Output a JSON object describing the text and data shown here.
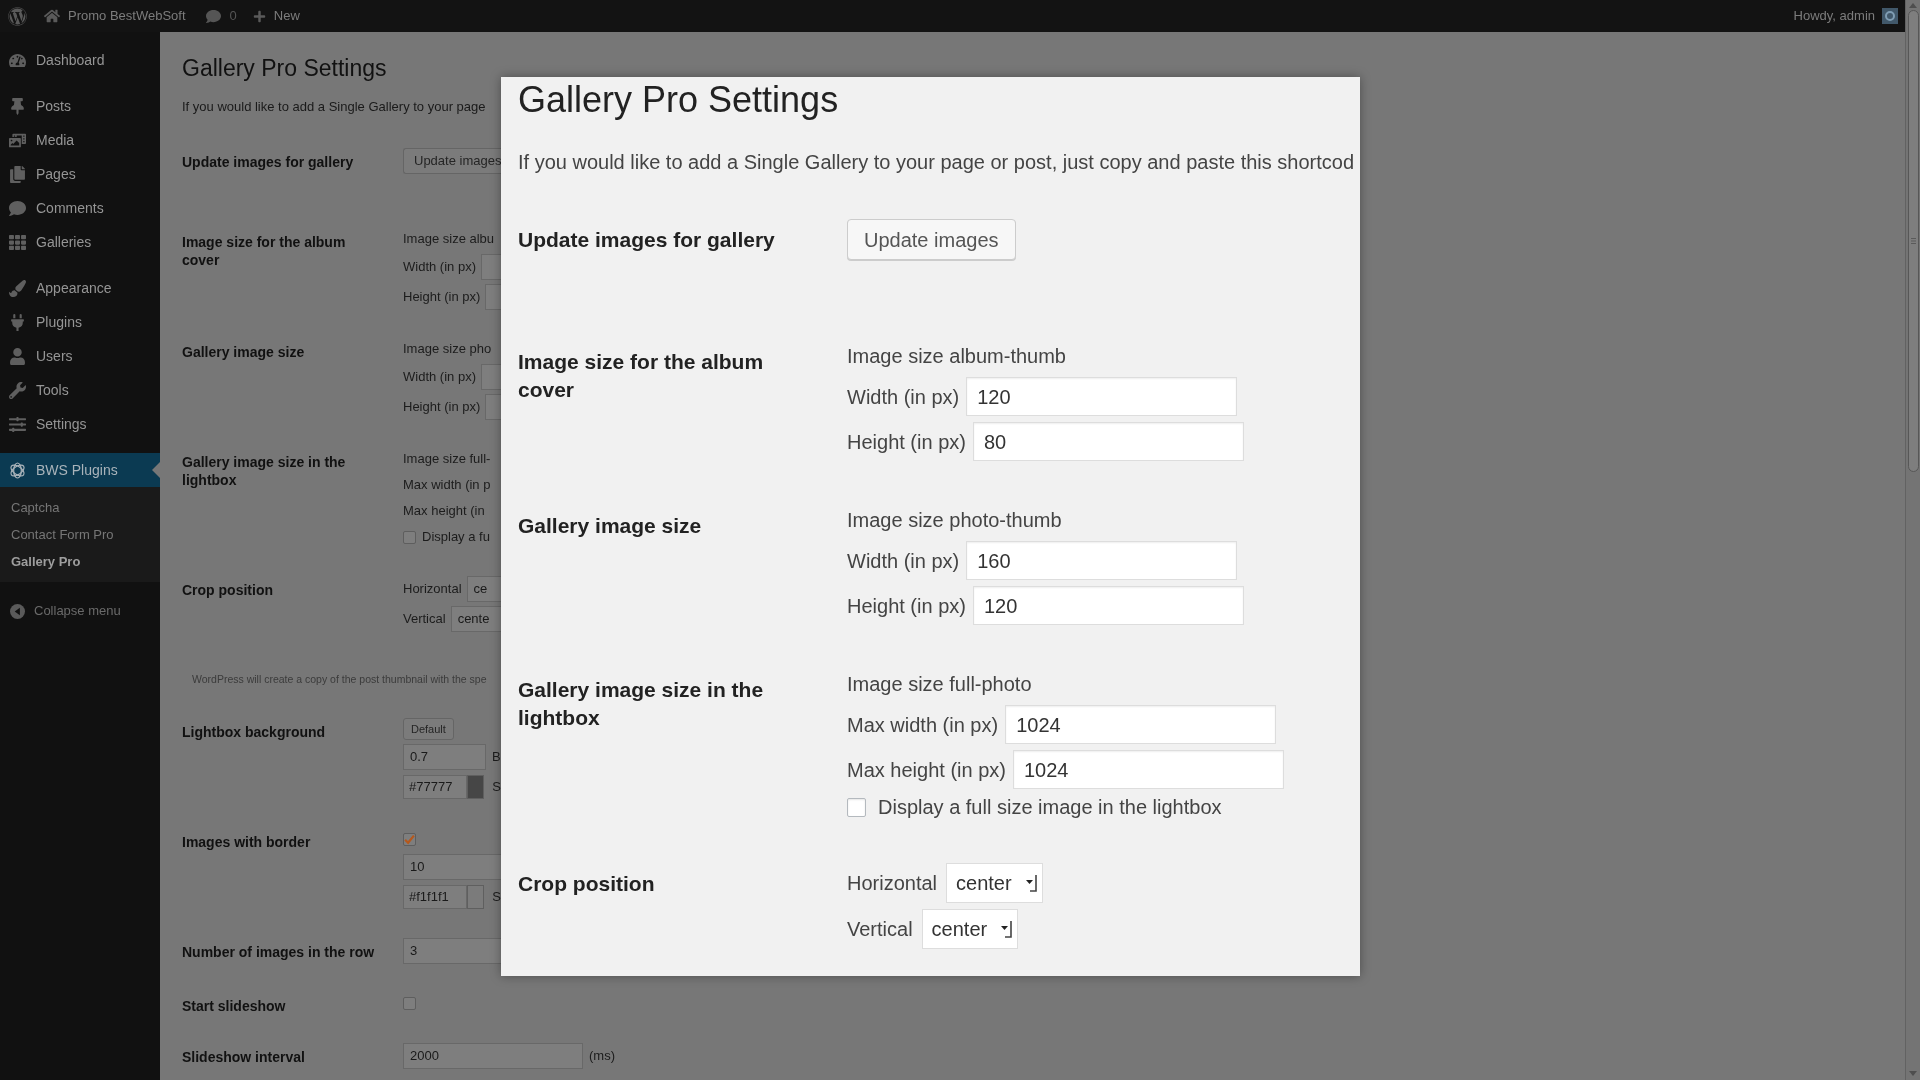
{
  "admin_bar": {
    "site_name": "Promo BestWebSoft",
    "comments": "0",
    "new_label": "New",
    "greeting": "Howdy, admin"
  },
  "sidebar": {
    "groups": [
      [
        {
          "label": "Dashboard",
          "selected": false
        }
      ],
      [
        {
          "label": "Posts",
          "selected": false
        },
        {
          "label": "Media",
          "selected": false
        },
        {
          "label": "Pages",
          "selected": false
        },
        {
          "label": "Comments",
          "selected": false
        },
        {
          "label": "Galleries",
          "selected": false
        }
      ],
      [
        {
          "label": "Appearance",
          "selected": false
        },
        {
          "label": "Plugins",
          "selected": false
        },
        {
          "label": "Users",
          "selected": false
        },
        {
          "label": "Tools",
          "selected": false
        },
        {
          "label": "Settings",
          "selected": false
        }
      ],
      [
        {
          "label": "BWS Plugins",
          "selected": true,
          "children": [
            {
              "label": "Captcha",
              "selected": false
            },
            {
              "label": "Contact Form Pro",
              "selected": false
            },
            {
              "label": "Gallery Pro",
              "selected": true
            }
          ]
        }
      ]
    ],
    "collapse_label": "Collapse menu"
  },
  "page": {
    "title": "Gallery Pro Settings",
    "description": "If you would like to add a Single Gallery to your page",
    "rows": [
      {
        "kind": "setting",
        "label": "Update images for gallery",
        "fields": [
          {
            "kind": "button",
            "label": "Update images"
          }
        ]
      },
      {
        "kind": "setting",
        "label": "Image size for the album cover",
        "fields": [
          {
            "kind": "caption",
            "text": "Image size albu"
          },
          {
            "kind": "input",
            "label": "Width (in px)"
          },
          {
            "kind": "input",
            "label": "Height (in px)"
          }
        ]
      },
      {
        "kind": "setting",
        "label": "Gallery image size",
        "fields": [
          {
            "kind": "caption",
            "text": "Image size pho"
          },
          {
            "kind": "input",
            "label": "Width (in px)"
          },
          {
            "kind": "input",
            "label": "Height (in px)"
          }
        ]
      },
      {
        "kind": "setting",
        "label": "Gallery image size in the lightbox",
        "fields": [
          {
            "kind": "caption",
            "text": "Image size full-"
          },
          {
            "kind": "caption",
            "text": "Max width (in p"
          },
          {
            "kind": "caption",
            "text": "Max height (in"
          },
          {
            "kind": "checkbox",
            "label": "Display a fu",
            "checked": false
          }
        ]
      },
      {
        "kind": "setting",
        "label": "Crop position",
        "fields": [
          {
            "kind": "select",
            "label": "Horizontal",
            "value": "ce"
          },
          {
            "kind": "select",
            "label": "Vertical",
            "value": "cente"
          }
        ]
      },
      {
        "kind": "note",
        "text": "WordPress will create a copy of the post thumbnail with the spe"
      },
      {
        "kind": "setting",
        "label": "Lightbox background",
        "fields": [
          {
            "kind": "button",
            "label": "Default"
          },
          {
            "kind": "input",
            "value": "0.7",
            "suffix": "B"
          },
          {
            "kind": "color",
            "value": "#77777",
            "color": "#464646",
            "suffix": "S"
          }
        ]
      },
      {
        "kind": "setting",
        "label": "Images with border",
        "fields": [
          {
            "kind": "checkbox",
            "checked": true
          },
          {
            "kind": "input",
            "value": "10"
          },
          {
            "kind": "color",
            "value": "#f1f1f1",
            "color": "#7b7b7b",
            "suffix": "S"
          }
        ]
      },
      {
        "kind": "setting",
        "label": "Number of images in the row",
        "fields": [
          {
            "kind": "input",
            "value": "3"
          }
        ]
      },
      {
        "kind": "setting",
        "label": "Start slideshow",
        "fields": [
          {
            "kind": "checkbox",
            "checked": false
          }
        ]
      },
      {
        "kind": "setting",
        "label": "Slideshow interval",
        "fields": [
          {
            "kind": "input",
            "value": "2000",
            "suffix": "(ms)"
          }
        ]
      }
    ]
  },
  "dialog": {
    "title": "Gallery Pro Settings",
    "description": "If you would like to add a Single Gallery to your page or post, just copy and paste this shortcod",
    "rows": [
      {
        "label": "Update images for gallery",
        "fields": [
          {
            "kind": "button",
            "label": "Update images"
          }
        ]
      },
      {
        "label": "Image size for the album cover",
        "fields": [
          {
            "kind": "caption",
            "text": "Image size album-thumb"
          },
          {
            "kind": "input",
            "label": "Width (in px)",
            "value": "120"
          },
          {
            "kind": "input",
            "label": "Height (in px)",
            "value": "80"
          }
        ]
      },
      {
        "label": "Gallery image size",
        "fields": [
          {
            "kind": "caption",
            "text": "Image size photo-thumb"
          },
          {
            "kind": "input",
            "label": "Width (in px)",
            "value": "160"
          },
          {
            "kind": "input",
            "label": "Height (in px)",
            "value": "120"
          }
        ]
      },
      {
        "label": "Gallery image size in the lightbox",
        "fields": [
          {
            "kind": "caption",
            "text": "Image size full-photo"
          },
          {
            "kind": "input",
            "label": "Max width (in px)",
            "value": "1024"
          },
          {
            "kind": "input",
            "label": "Max height (in px)",
            "value": "1024"
          },
          {
            "kind": "checkbox",
            "label": "Display a full size image in the lightbox",
            "checked": false
          }
        ]
      },
      {
        "label": "Crop position",
        "fields": [
          {
            "kind": "select",
            "label": "Horizontal",
            "value": "center"
          },
          {
            "kind": "select",
            "label": "Vertical",
            "value": "center"
          }
        ]
      }
    ]
  }
}
